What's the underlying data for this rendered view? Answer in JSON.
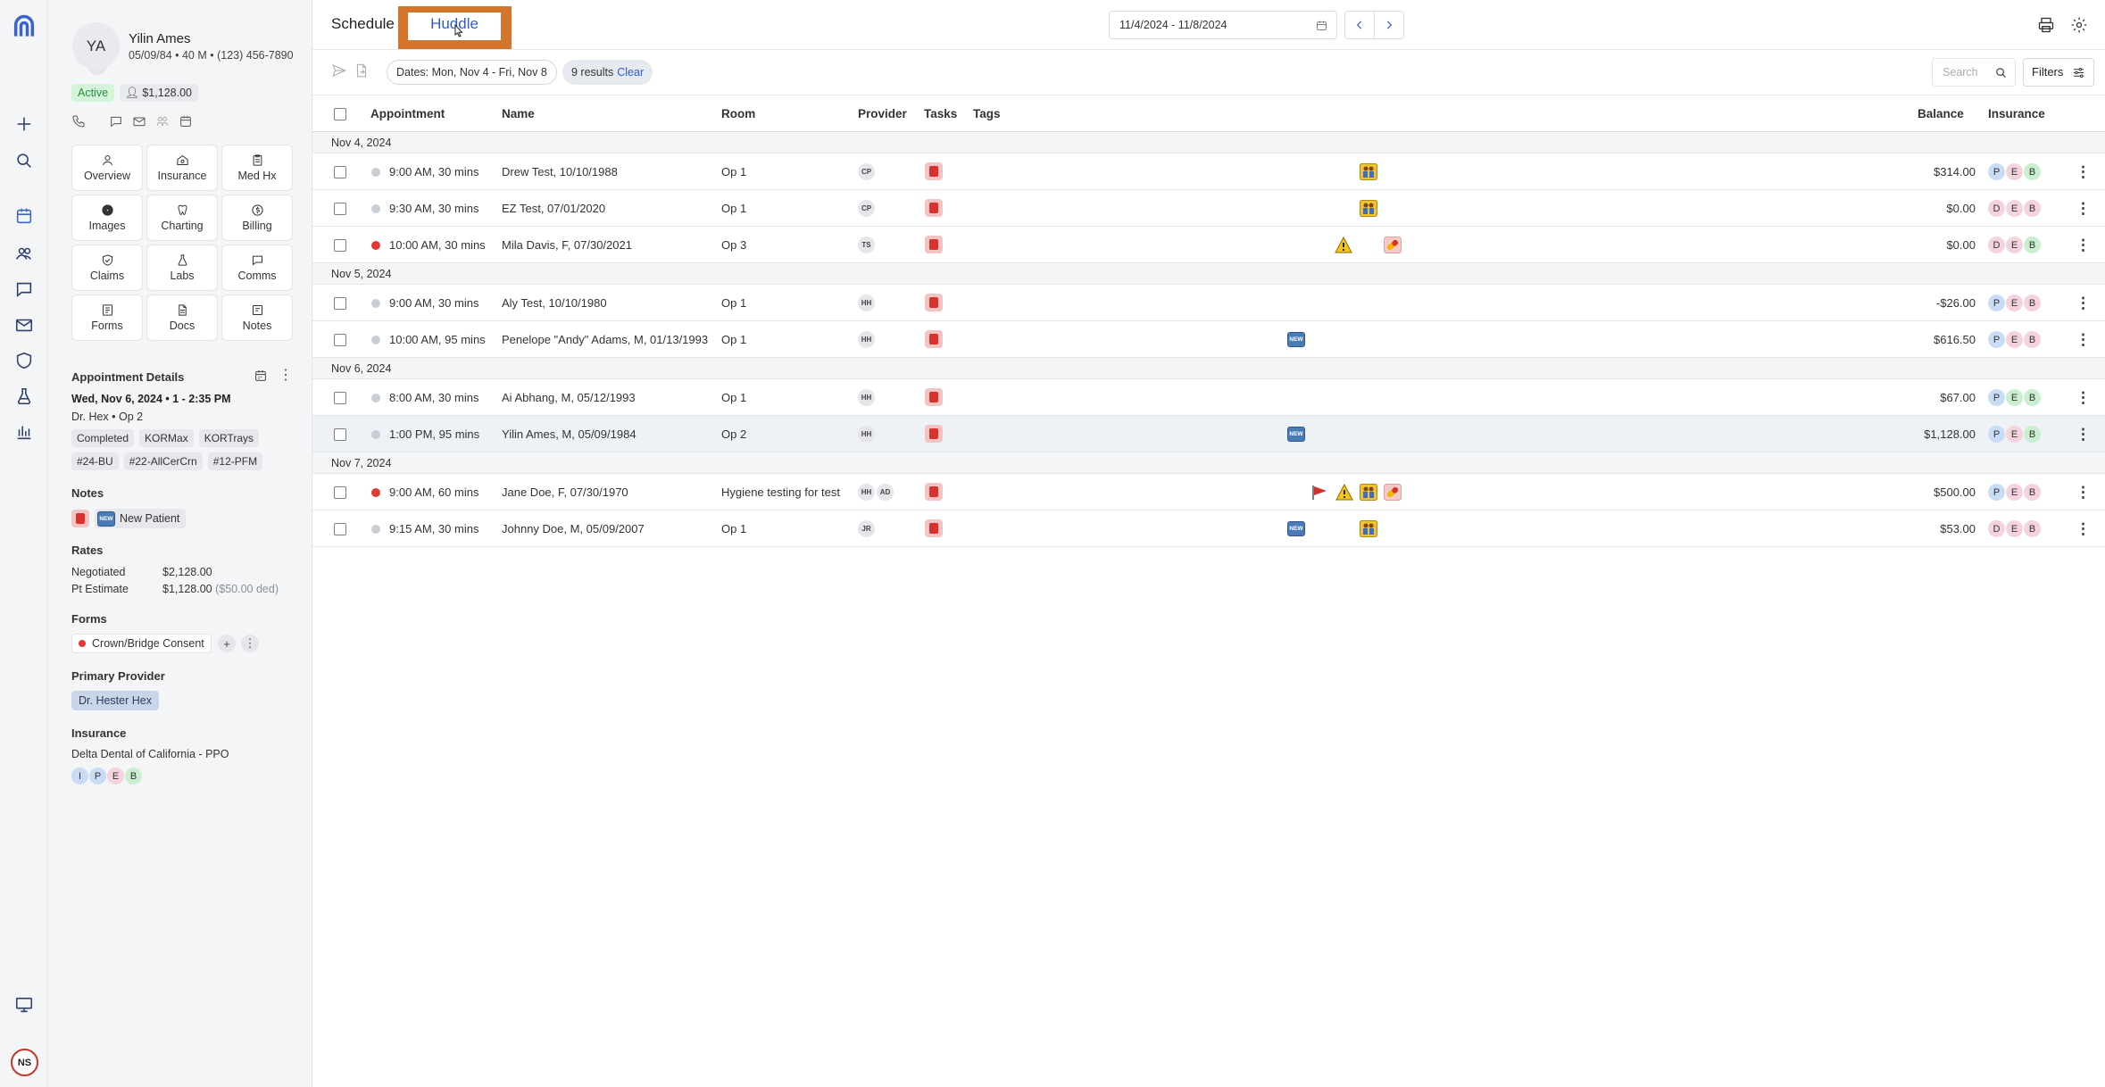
{
  "rail": {
    "icons": [
      "logo-icon",
      "collapse-arrow-icon",
      "plus-icon",
      "search-icon",
      "schedule-icon",
      "patients-icon",
      "chat-icon",
      "mail-icon",
      "shield-icon",
      "lab-flask-icon",
      "analytics-icon",
      "display-icon"
    ],
    "user_initials": "NS"
  },
  "patient": {
    "initials": "YA",
    "name": "Yilin Ames",
    "meta": "05/09/84 • 40 M • (123) 456-7890",
    "status": "Active",
    "balance": "$1,128.00",
    "nav": [
      {
        "label": "Overview",
        "icon": "user-icon"
      },
      {
        "label": "Insurance",
        "icon": "insurance-icon"
      },
      {
        "label": "Med Hx",
        "icon": "clipboard-icon"
      },
      {
        "label": "Images",
        "icon": "radiation-icon"
      },
      {
        "label": "Charting",
        "icon": "tooth-icon"
      },
      {
        "label": "Billing",
        "icon": "billing-icon"
      },
      {
        "label": "Claims",
        "icon": "shield-check-icon"
      },
      {
        "label": "Labs",
        "icon": "flask-icon"
      },
      {
        "label": "Comms",
        "icon": "message-icon"
      },
      {
        "label": "Forms",
        "icon": "forms-icon"
      },
      {
        "label": "Docs",
        "icon": "document-icon"
      },
      {
        "label": "Notes",
        "icon": "notes-icon"
      }
    ]
  },
  "appointment": {
    "title": "Appointment Details",
    "datetime": "Wed, Nov 6, 2024 • 1 - 2:35 PM",
    "provider_op": "Dr. Hex • Op 2",
    "tags_row1": [
      "Completed",
      "KORMax",
      "KORTrays"
    ],
    "tags_row2": [
      "#24-BU",
      "#22-AllCerCrn",
      "#12-PFM"
    ]
  },
  "notes": {
    "title": "Notes",
    "new_label": "New Patient",
    "new_badge": "NEW"
  },
  "rates": {
    "title": "Rates",
    "negotiated_label": "Negotiated",
    "negotiated_value": "$2,128.00",
    "estimate_label": "Pt Estimate",
    "estimate_value": "$1,128.00",
    "estimate_ded": "($50.00 ded)"
  },
  "forms": {
    "title": "Forms",
    "item": "Crown/Bridge Consent",
    "add": "+",
    "more": "⋮"
  },
  "primary_provider": {
    "title": "Primary Provider",
    "name": "Dr. Hester Hex"
  },
  "insurance": {
    "title": "Insurance",
    "plan": "Delta Dental of California - PPO",
    "codes": [
      "I",
      "P",
      "E",
      "B"
    ]
  },
  "header": {
    "tab_schedule": "Schedule",
    "tab_huddle": "Huddle",
    "date_range": "11/4/2024 - 11/8/2024"
  },
  "filterbar": {
    "dates_chip": "Dates: Mon, Nov 4 - Fri, Nov 8",
    "results": "9 results",
    "clear": "Clear",
    "search_placeholder": "Search",
    "filters_label": "Filters"
  },
  "table": {
    "columns": [
      "Appointment",
      "Name",
      "Room",
      "Provider",
      "Tasks",
      "Tags",
      "Balance",
      "Insurance"
    ],
    "groups": [
      {
        "date": "Nov 4, 2024",
        "rows": [
          {
            "time": "9:00 AM, 30 mins",
            "status": "grey",
            "name": "Drew Test, 10/10/1988",
            "room": "Op 1",
            "providers": [
              "CP"
            ],
            "tags": [
              "family"
            ],
            "balance": "$314.00",
            "insurance": [
              "P",
              "E",
              "B"
            ],
            "ins_colors": [
              "blue",
              "pink",
              "green"
            ]
          },
          {
            "time": "9:30 AM, 30 mins",
            "status": "grey",
            "name": "EZ Test, 07/01/2020",
            "room": "Op 1",
            "providers": [
              "CP"
            ],
            "tags": [
              "family"
            ],
            "balance": "$0.00",
            "insurance": [
              "D",
              "E",
              "B"
            ],
            "ins_colors": [
              "pink",
              "pink",
              "pink"
            ]
          },
          {
            "time": "10:00 AM, 30 mins",
            "status": "red",
            "name": "Mila Davis, F, 07/30/2021",
            "room": "Op 3",
            "providers": [
              "TS"
            ],
            "tags": [
              "warning",
              "pill"
            ],
            "balance": "$0.00",
            "insurance": [
              "D",
              "E",
              "B"
            ],
            "ins_colors": [
              "pink",
              "pink",
              "green"
            ]
          }
        ]
      },
      {
        "date": "Nov 5, 2024",
        "rows": [
          {
            "time": "9:00 AM, 30 mins",
            "status": "grey",
            "name": "Aly Test, 10/10/1980",
            "room": "Op 1",
            "providers": [
              "HH"
            ],
            "tags": [],
            "balance": "-$26.00",
            "insurance": [
              "P",
              "E",
              "B"
            ],
            "ins_colors": [
              "blue",
              "pink",
              "pink"
            ]
          },
          {
            "time": "10:00 AM, 95 mins",
            "status": "grey",
            "name": "Penelope \"Andy\" Adams, M, 01/13/1993",
            "room": "Op 1",
            "providers": [
              "HH"
            ],
            "tags": [
              "new"
            ],
            "balance": "$616.50",
            "insurance": [
              "P",
              "E",
              "B"
            ],
            "ins_colors": [
              "blue",
              "pink",
              "pink"
            ]
          }
        ]
      },
      {
        "date": "Nov 6, 2024",
        "rows": [
          {
            "time": "8:00 AM, 30 mins",
            "status": "grey",
            "name": "Ai Abhang, M, 05/12/1993",
            "room": "Op 1",
            "providers": [
              "HH"
            ],
            "tags": [],
            "balance": "$67.00",
            "insurance": [
              "P",
              "E",
              "B"
            ],
            "ins_colors": [
              "blue",
              "green",
              "green"
            ]
          },
          {
            "time": "1:00 PM, 95 mins",
            "status": "grey",
            "name": "Yilin Ames, M, 05/09/1984",
            "room": "Op 2",
            "providers": [
              "HH"
            ],
            "tags": [
              "new"
            ],
            "balance": "$1,128.00",
            "insurance": [
              "P",
              "E",
              "B"
            ],
            "ins_colors": [
              "blue",
              "pink",
              "green"
            ],
            "selected": true
          }
        ]
      },
      {
        "date": "Nov 7, 2024",
        "rows": [
          {
            "time": "9:00 AM, 60 mins",
            "status": "red",
            "name": "Jane Doe, F, 07/30/1970",
            "room": "Hygiene testing for test",
            "providers": [
              "HH",
              "AD"
            ],
            "tags": [
              "flag",
              "warning",
              "family",
              "pill"
            ],
            "balance": "$500.00",
            "insurance": [
              "P",
              "E",
              "B"
            ],
            "ins_colors": [
              "blue",
              "pink",
              "pink"
            ]
          },
          {
            "time": "9:15 AM, 30 mins",
            "status": "grey",
            "name": "Johnny Doe, M, 05/09/2007",
            "room": "Op 1",
            "providers": [
              "JR"
            ],
            "tags": [
              "new",
              "family"
            ],
            "balance": "$53.00",
            "insurance": [
              "D",
              "E",
              "B"
            ],
            "ins_colors": [
              "pink",
              "pink",
              "pink"
            ]
          }
        ]
      }
    ]
  }
}
